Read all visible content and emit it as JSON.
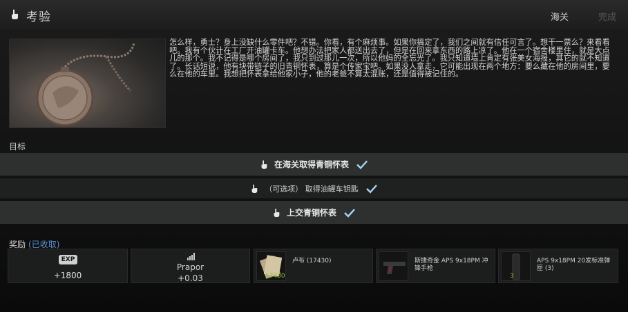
{
  "header": {
    "title": "考验",
    "location": "海关",
    "complete_label": "完成"
  },
  "description": "怎么样，勇士？身上没缺什么零件吧？不错。你看，有个麻烦事。如果你搞定了，我们之间就有信任可言了。想干一票么？来看看吧。我有个伙计在工厂开油罐卡车。他想办法把家人都送出去了，但是在回来拿东西的路上凉了。他在一个宿舍楼里住，就是大点儿的那个。我不记得是哪个房间了，我只到过那儿一次，所以他妈的全忘光了。我只知道墙上肯定有张美女海报，其它的就不知道了。长话短说，他有块带链子的旧青铜怀表，算是个传家宝吧。如果没人拿走，它可能出现在两个地方：要么藏在他的房间里，要么在他的车里。我想把怀表拿给他家小子，他的老爸不算太混账，还是值得被记住的。",
  "objectives": {
    "label": "目标",
    "items": [
      {
        "text": "在海关取得青铜怀表",
        "done": true
      },
      {
        "text": "（可选项） 取得油罐车钥匙",
        "done": true
      },
      {
        "text": "上交青铜怀表",
        "done": true
      }
    ]
  },
  "rewards": {
    "label": "奖励",
    "status": "(已收取)",
    "exp": {
      "badge": "EXP",
      "value": "+1800"
    },
    "trader": {
      "name": "Prapor",
      "value": "+0.03"
    },
    "items": [
      {
        "name": "卢布 (17430)",
        "qty": "17430",
        "icon": "money-icon"
      },
      {
        "name": "斯捷奇金 APS 9x18PM 冲锋手枪",
        "qty": "",
        "icon": "pistol-icon"
      },
      {
        "name": "APS 9x18PM 20发标准弹匣 (3)",
        "qty": "3",
        "icon": "magazine-icon"
      }
    ]
  },
  "colors": {
    "accent_blue": "#5b8fcf",
    "check_color": "#a9d6f5",
    "qty_green": "#8fbf3a"
  }
}
